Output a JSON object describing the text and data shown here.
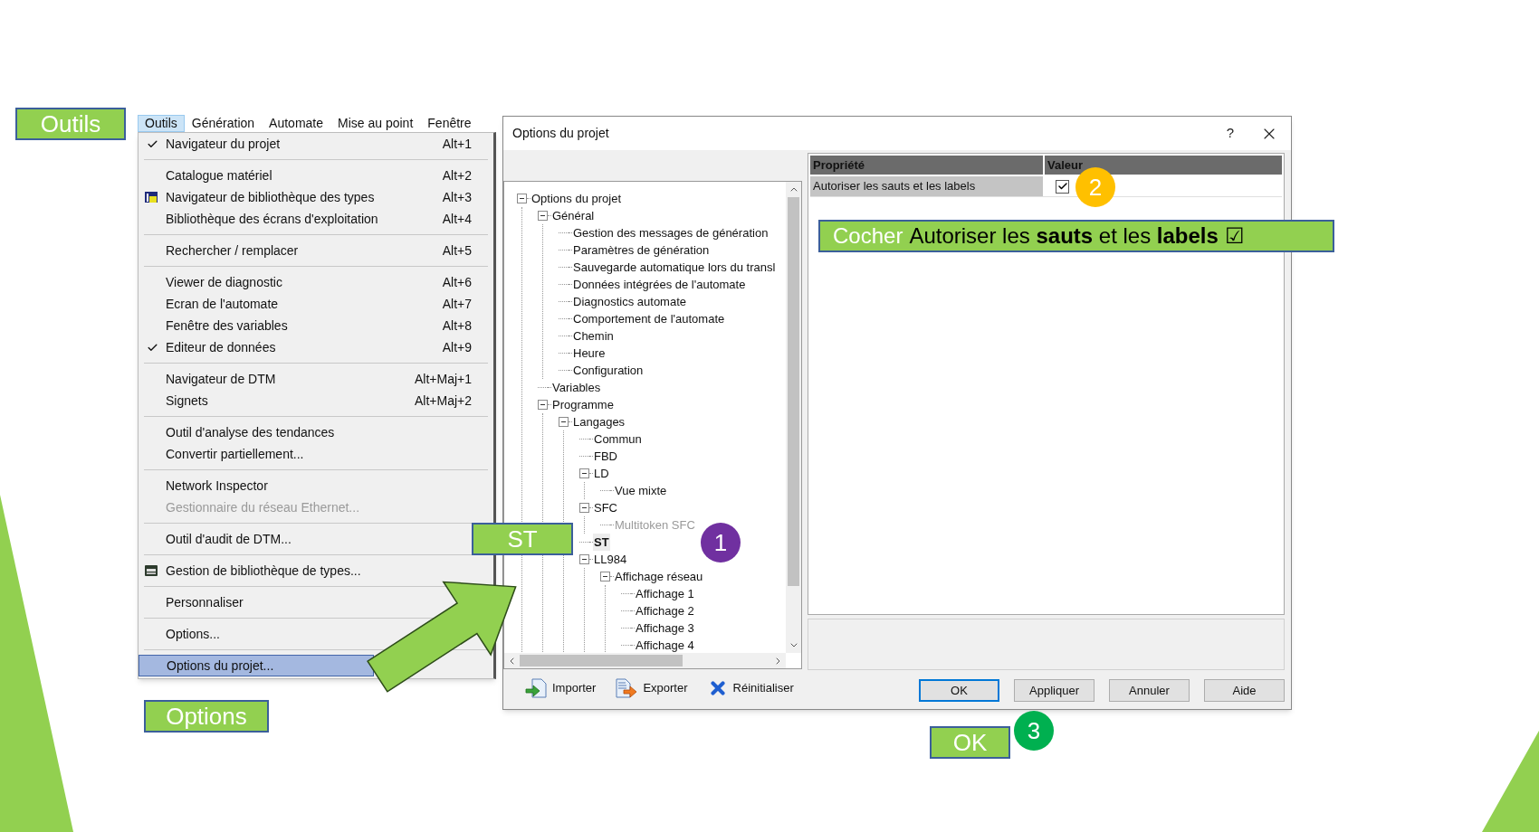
{
  "labels": [
    {
      "text": "Outils"
    },
    {
      "text": "Options"
    },
    {
      "text": "ST"
    },
    {
      "text": "OK"
    }
  ],
  "steps": [
    {
      "number": "1",
      "color": "#7030a0"
    },
    {
      "number": "2",
      "color": "#ffc000"
    },
    {
      "number": "3",
      "color": "#00b050"
    }
  ],
  "banner": {
    "verb": "Cocher",
    "text": "Autoriser les **sauts** et les **labels** ☑"
  },
  "menu": {
    "menubar": [
      {
        "label": "Outils",
        "selected": true
      },
      {
        "label": "Génération",
        "selected": false
      },
      {
        "label": "Automate",
        "selected": false
      },
      {
        "label": "Mise au point",
        "selected": false
      },
      {
        "label": "Fenêtre",
        "selected": false
      }
    ],
    "items": [
      {
        "kind": "item",
        "label": "Navigateur du projet",
        "shortcut": "Alt+1",
        "checked": true,
        "disabled": false,
        "selected": false
      },
      {
        "kind": "separator"
      },
      {
        "kind": "item",
        "label": "Catalogue matériel",
        "shortcut": "Alt+2",
        "checked": false,
        "disabled": false,
        "selected": false
      },
      {
        "kind": "item",
        "label": "Navigateur de bibliothèque des types",
        "shortcut": "Alt+3",
        "checked": false,
        "disabled": false,
        "selected": false
      },
      {
        "kind": "item",
        "label": "Bibliothèque des écrans d'exploitation",
        "shortcut": "Alt+4",
        "checked": false,
        "disabled": false,
        "selected": false
      },
      {
        "kind": "separator"
      },
      {
        "kind": "item",
        "label": "Rechercher / remplacer",
        "shortcut": "Alt+5",
        "checked": false,
        "disabled": false,
        "selected": false
      },
      {
        "kind": "separator"
      },
      {
        "kind": "item",
        "label": "Viewer de diagnostic",
        "shortcut": "Alt+6",
        "checked": false,
        "disabled": false,
        "selected": false
      },
      {
        "kind": "item",
        "label": "Ecran de l'automate",
        "shortcut": "Alt+7",
        "checked": false,
        "disabled": false,
        "selected": false
      },
      {
        "kind": "item",
        "label": "Fenêtre des variables",
        "shortcut": "Alt+8",
        "checked": false,
        "disabled": false,
        "selected": false
      },
      {
        "kind": "item",
        "label": "Editeur de données",
        "shortcut": "Alt+9",
        "checked": true,
        "disabled": false,
        "selected": false
      },
      {
        "kind": "separator"
      },
      {
        "kind": "item",
        "label": "Navigateur de DTM",
        "shortcut": "Alt+Maj+1",
        "checked": false,
        "disabled": false,
        "selected": false
      },
      {
        "kind": "item",
        "label": "Signets",
        "shortcut": "Alt+Maj+2",
        "checked": false,
        "disabled": false,
        "selected": false
      },
      {
        "kind": "separator"
      },
      {
        "kind": "item",
        "label": "Outil d'analyse des tendances",
        "checked": false,
        "disabled": false,
        "selected": false
      },
      {
        "kind": "item",
        "label": "Convertir partiellement...",
        "checked": false,
        "disabled": false,
        "selected": false
      },
      {
        "kind": "separator"
      },
      {
        "kind": "item",
        "label": "Network Inspector",
        "checked": false,
        "disabled": false,
        "selected": false
      },
      {
        "kind": "item",
        "label": "Gestionnaire du réseau Ethernet...",
        "checked": false,
        "disabled": true,
        "selected": false
      },
      {
        "kind": "separator"
      },
      {
        "kind": "item",
        "label": "Outil d'audit de DTM...",
        "checked": false,
        "disabled": false,
        "selected": false
      },
      {
        "kind": "separator"
      },
      {
        "kind": "item",
        "label": "Gestion de bibliothèque de types...",
        "checked": false,
        "disabled": false,
        "selected": false
      },
      {
        "kind": "separator"
      },
      {
        "kind": "item",
        "label": "Personnaliser",
        "checked": false,
        "disabled": false,
        "selected": false
      },
      {
        "kind": "separator"
      },
      {
        "kind": "item",
        "label": "Options...",
        "checked": false,
        "disabled": false,
        "selected": false
      },
      {
        "kind": "separator"
      },
      {
        "kind": "item",
        "label": "Options du projet...",
        "checked": false,
        "disabled": false,
        "selected": true
      }
    ]
  },
  "dialog": {
    "title": "Options du projet",
    "help": "?",
    "tree": [
      {
        "label": "Options du projet",
        "expanded": true,
        "selected": false,
        "disabled": false,
        "children": [
          {
            "label": "Général",
            "expanded": true,
            "selected": false,
            "disabled": false,
            "children": [
              {
                "label": "Gestion des messages de génération",
                "selected": false,
                "disabled": false
              },
              {
                "label": "Paramètres de génération",
                "selected": false,
                "disabled": false
              },
              {
                "label": "Sauvegarde automatique lors du transl",
                "selected": false,
                "disabled": false
              },
              {
                "label": "Données intégrées de l'automate",
                "selected": false,
                "disabled": false
              },
              {
                "label": "Diagnostics automate",
                "selected": false,
                "disabled": false
              },
              {
                "label": "Comportement de l'automate",
                "selected": false,
                "disabled": false
              },
              {
                "label": "Chemin",
                "selected": false,
                "disabled": false
              },
              {
                "label": "Heure",
                "selected": false,
                "disabled": false
              },
              {
                "label": "Configuration",
                "selected": false,
                "disabled": false
              }
            ]
          },
          {
            "label": "Variables",
            "selected": false,
            "disabled": false
          },
          {
            "label": "Programme",
            "expanded": true,
            "selected": false,
            "disabled": false,
            "children": [
              {
                "label": "Langages",
                "expanded": true,
                "selected": false,
                "disabled": false,
                "children": [
                  {
                    "label": "Commun",
                    "selected": false,
                    "disabled": false
                  },
                  {
                    "label": "FBD",
                    "selected": false,
                    "disabled": false
                  },
                  {
                    "label": "LD",
                    "expanded": true,
                    "selected": false,
                    "disabled": false,
                    "children": [
                      {
                        "label": "Vue mixte",
                        "selected": false,
                        "disabled": false
                      }
                    ]
                  },
                  {
                    "label": "SFC",
                    "expanded": true,
                    "selected": false,
                    "disabled": false,
                    "children": [
                      {
                        "label": "Multitoken SFC",
                        "selected": false,
                        "disabled": true
                      }
                    ]
                  },
                  {
                    "label": "ST",
                    "selected": true,
                    "disabled": false
                  },
                  {
                    "label": "LL984",
                    "expanded": true,
                    "selected": false,
                    "disabled": false,
                    "children": [
                      {
                        "label": "Affichage réseau",
                        "expanded": true,
                        "selected": false,
                        "disabled": false,
                        "children": [
                          {
                            "label": "Affichage 1",
                            "selected": false,
                            "disabled": false
                          },
                          {
                            "label": "Affichage 2",
                            "selected": false,
                            "disabled": false
                          },
                          {
                            "label": "Affichage 3",
                            "selected": false,
                            "disabled": false
                          },
                          {
                            "label": "Affichage 4",
                            "selected": false,
                            "disabled": false
                          }
                        ]
                      }
                    ]
                  }
                ]
              }
            ]
          }
        ]
      }
    ],
    "columns": [
      "Propriété",
      "Valeur"
    ],
    "rows": [
      {
        "property": "Autoriser les sauts et les labels",
        "checked": true,
        "selected": true
      }
    ],
    "tools": [
      {
        "label": "Importer"
      },
      {
        "label": "Exporter"
      },
      {
        "label": "Réinitialiser"
      }
    ],
    "buttons": [
      {
        "label": "OK",
        "default": true
      },
      {
        "label": "Appliquer",
        "default": false
      },
      {
        "label": "Annuler",
        "default": false
      },
      {
        "label": "Aide",
        "default": false
      }
    ]
  }
}
